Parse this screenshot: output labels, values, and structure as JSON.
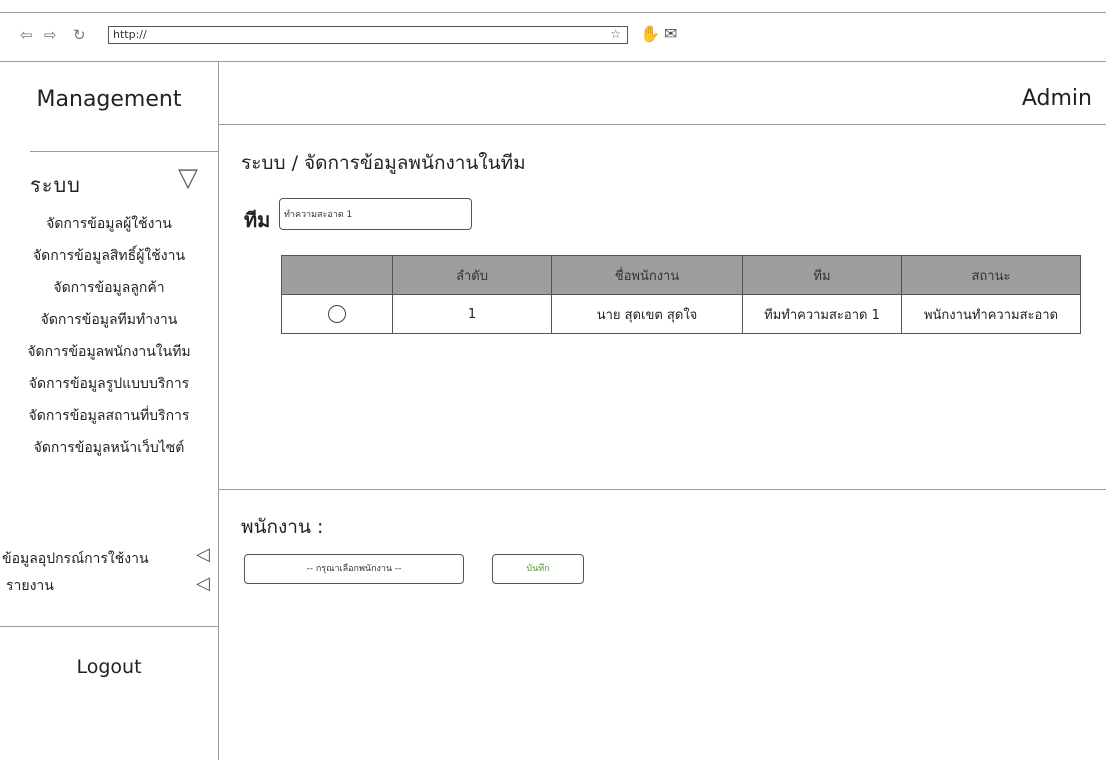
{
  "browser": {
    "back_icon": "⇦",
    "forward_icon": "⇨",
    "reload_icon": "↻",
    "url": "http://",
    "star_icon": "☆",
    "ext_icon": "✋",
    "mail_icon": "✉"
  },
  "sidebar": {
    "title": "Management",
    "section": "ระบบ",
    "section_toggle": "▽",
    "items": [
      "จัดการข้อมูลผู้ใช้งาน",
      "จัดการข้อมูลสิทธิ์ผู้ใช้งาน",
      "จัดการข้อมูลลูกค้า",
      "จัดการข้อมูลทีมทำงาน",
      "จัดการข้อมูลพนักงานในทีม",
      "จัดการข้อมูลรูปแบบบริการ",
      "จัดการข้อมูลสถานที่บริการ",
      "จัดการข้อมูลหน้าเว็บไซต์"
    ],
    "extra_items": [
      {
        "label": "ข้อมูลอุปกรณ์การใช้งาน",
        "arrow": "◁"
      },
      {
        "label": "รายงาน",
        "arrow": "◁"
      }
    ],
    "logout": "Logout"
  },
  "header": {
    "user": "Admin"
  },
  "main": {
    "breadcrumb": "ระบบ / จัดการข้อมูลพนักงานในทีม",
    "team_label": "ทีม",
    "team_value": "ทำความสะอาด 1",
    "table": {
      "headers": [
        "",
        "ลำดับ",
        "ชื่อพนักงาน",
        "ทีม",
        "สถานะ"
      ],
      "rows": [
        [
          "",
          "1",
          "นาย สุดเขต สุดใจ",
          "ทีมทำความสะอาด 1",
          "พนักงานทำความสะอาด"
        ]
      ]
    },
    "employee_label": "พนักงาน :",
    "employee_select": "-- กรุณาเลือกพนักงาน --",
    "save_button": "บันทึก"
  }
}
